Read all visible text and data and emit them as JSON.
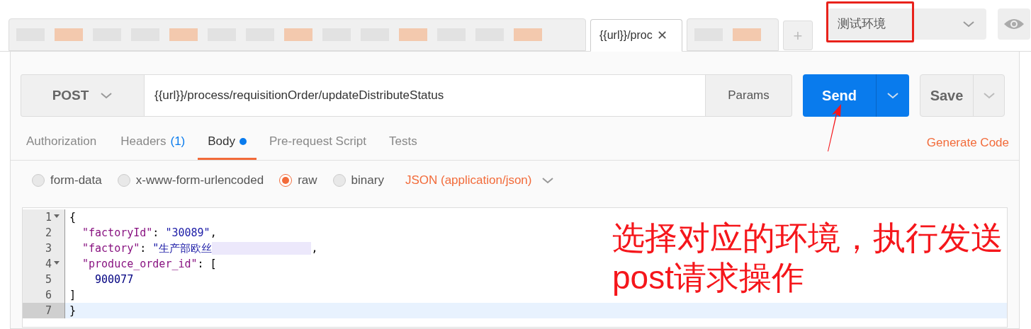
{
  "tabs": [
    {
      "kind": "redacted",
      "selected": false
    },
    {
      "kind": "tab",
      "label": "{{url}}/proc",
      "close": "✕",
      "selected": true
    },
    {
      "kind": "redacted",
      "selected": false
    }
  ],
  "new_tab": "+",
  "environment": {
    "value": "测试环境",
    "highlighted": true
  },
  "request": {
    "method": "POST",
    "url": "{{url}}/process/requisitionOrder/updateDistributeStatus",
    "params": "Params",
    "send": "Send",
    "save": "Save"
  },
  "sub_tabs": [
    {
      "label": "Authorization",
      "selected": false
    },
    {
      "label": "Headers",
      "count": "(1)",
      "selected": false
    },
    {
      "label": "Body",
      "dot": true,
      "selected": true
    },
    {
      "label": "Pre-request Script",
      "selected": false
    },
    {
      "label": "Tests",
      "selected": false
    }
  ],
  "generate_code": "Generate Code",
  "body_modes": [
    {
      "label": "form-data",
      "selected": false
    },
    {
      "label": "x-www-form-urlencoded",
      "selected": false
    },
    {
      "label": "raw",
      "selected": true
    },
    {
      "label": "binary",
      "selected": false
    }
  ],
  "content_type": "JSON (application/json)",
  "code_lines": [
    {
      "number": "1",
      "fold": true,
      "active": false,
      "tokens": [
        {
          "kind": "punct",
          "text": "{"
        }
      ]
    },
    {
      "number": "2",
      "fold": false,
      "active": false,
      "tokens": [
        {
          "kind": "key",
          "text": "\"factoryId\""
        },
        {
          "kind": "punct",
          "text": ": "
        },
        {
          "kind": "string",
          "text": "\"30089\""
        },
        {
          "kind": "punct",
          "text": ","
        }
      ]
    },
    {
      "number": "3",
      "fold": false,
      "active": false,
      "tokens": [
        {
          "kind": "key",
          "text": "\"factory\""
        },
        {
          "kind": "punct",
          "text": ": "
        },
        {
          "kind": "string",
          "text": "\"生产部欧丝"
        },
        {
          "kind": "redacted"
        },
        {
          "kind": "punct",
          "text": ","
        }
      ]
    },
    {
      "number": "4",
      "fold": true,
      "active": false,
      "tokens": [
        {
          "kind": "key",
          "text": "\"produce_order_id\""
        },
        {
          "kind": "punct",
          "text": ": ["
        }
      ]
    },
    {
      "number": "5",
      "fold": false,
      "active": false,
      "tokens": [
        {
          "kind": "number",
          "text": "  900077"
        }
      ]
    },
    {
      "number": "6",
      "fold": false,
      "active": false,
      "tokens": [
        {
          "kind": "punct",
          "text": "]"
        }
      ]
    },
    {
      "number": "7",
      "fold": false,
      "active": true,
      "tokens": [
        {
          "kind": "punct",
          "text": "}"
        }
      ]
    }
  ],
  "annotation": {
    "text": "选择对应的环境，执行发送post请求操作"
  }
}
